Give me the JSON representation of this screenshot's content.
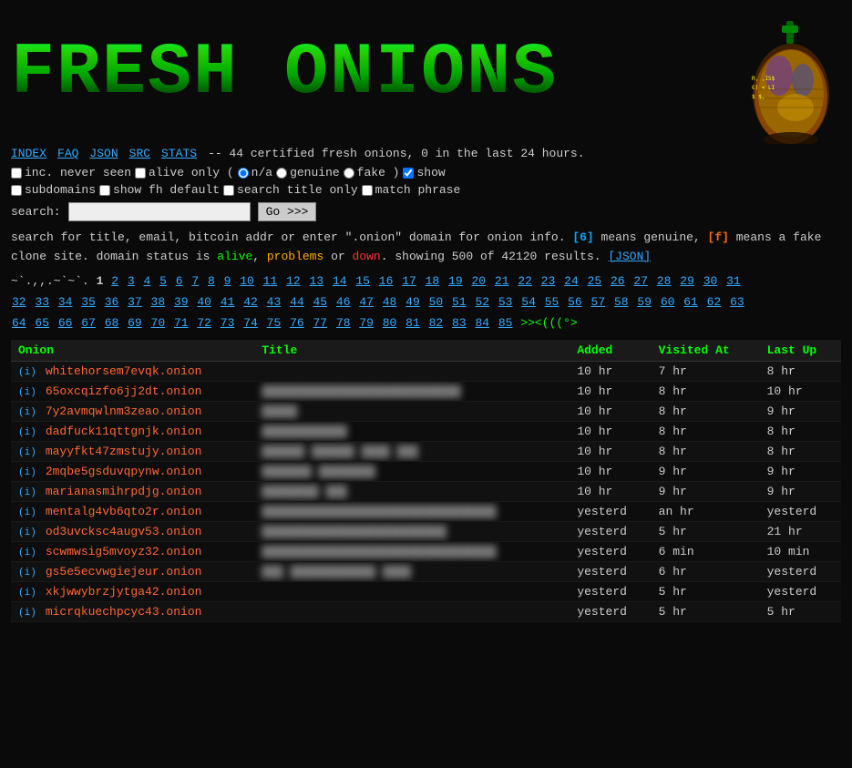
{
  "logo": {
    "text": "FR€SH ON¡ONS",
    "display": "FRESH ONIONS"
  },
  "nav": {
    "links": [
      {
        "label": "INDEX",
        "id": "index"
      },
      {
        "label": "FAQ",
        "id": "faq"
      },
      {
        "label": "JSON",
        "id": "json"
      },
      {
        "label": "SRC",
        "id": "src"
      },
      {
        "label": "STATS",
        "id": "stats"
      }
    ],
    "tagline": "-- 44 certified fresh onions, 0 in the last 24 hours."
  },
  "options": {
    "inc_never_seen": false,
    "alive_only": false,
    "status": "n/a",
    "show_subdomains": false,
    "show_fh_default": false,
    "search_title_only": false,
    "match_phrase": false,
    "show_checked": true
  },
  "search": {
    "label": "search:",
    "placeholder": "",
    "button": "Go >>>"
  },
  "help": {
    "line1": "search for title, email, bitcoin addr or enter \".onion\" domain for onion info.",
    "genuine_label": "[G]",
    "genuine_desc": "means genuine,",
    "fake_label": "[F]",
    "fake_desc": "means a fake clone site. domain status is",
    "alive": "alive",
    "problems": "problems",
    "or": "or",
    "down": "down",
    "showing": ". showing 500 of 42120 results.",
    "json_link": "[JSON]"
  },
  "pagination": {
    "sym_start": "~`.,,.~`~`.",
    "current": "1",
    "pages": [
      "2",
      "3",
      "4",
      "5",
      "6",
      "7",
      "8",
      "9",
      "10",
      "11",
      "12",
      "13",
      "14",
      "15",
      "16",
      "17",
      "18",
      "19",
      "20",
      "21",
      "22",
      "23",
      "24",
      "25",
      "26",
      "27",
      "28",
      "29",
      "30",
      "31",
      "32",
      "33",
      "34",
      "35",
      "36",
      "37",
      "38",
      "39",
      "40",
      "41",
      "42",
      "43",
      "44",
      "45",
      "46",
      "47",
      "48",
      "49",
      "50",
      "51",
      "52",
      "53",
      "54",
      "55",
      "56",
      "57",
      "58",
      "59",
      "60",
      "61",
      "62",
      "63",
      "64",
      "65",
      "66",
      "67",
      "68",
      "69",
      "70",
      "71",
      "72",
      "73",
      "74",
      "75",
      "76",
      "77",
      "78",
      "79",
      "80",
      "81",
      "82",
      "83",
      "84",
      "85"
    ],
    "end_sym": ">><(((°>"
  },
  "table": {
    "headers": [
      "Onion",
      "Title",
      "Added",
      "Visited At",
      "Last Up"
    ],
    "rows": [
      {
        "i": "i",
        "onion": "whitehorsem7evqk.onion",
        "title": "",
        "added": "10 hr",
        "visited": "7 hr",
        "last_up": "8 hr",
        "blurred": false
      },
      {
        "i": "i",
        "onion": "65oxcqizfo6jj2dt.onion",
        "title": "████████████████████████████",
        "added": "10 hr",
        "visited": "8 hr",
        "last_up": "10 hr",
        "blurred": true
      },
      {
        "i": "i",
        "onion": "7y2avmqwlnm3zeao.onion",
        "title": "█████",
        "added": "10 hr",
        "visited": "8 hr",
        "last_up": "9 hr",
        "blurred": true
      },
      {
        "i": "i",
        "onion": "dadfuck11qttgnjk.onion",
        "title": "████████████",
        "added": "10 hr",
        "visited": "8 hr",
        "last_up": "8 hr",
        "blurred": true
      },
      {
        "i": "i",
        "onion": "mayyfkt47zmstujy.onion",
        "title": "██████ ██████ ████ ███",
        "added": "10 hr",
        "visited": "8 hr",
        "last_up": "8 hr",
        "blurred": true
      },
      {
        "i": "i",
        "onion": "2mqbe5gsduvqpynw.onion",
        "title": "███████ ████████",
        "added": "10 hr",
        "visited": "9 hr",
        "last_up": "9 hr",
        "blurred": true
      },
      {
        "i": "i",
        "onion": "marianasmihrpdjg.onion",
        "title": "████████ ███",
        "added": "10 hr",
        "visited": "9 hr",
        "last_up": "9 hr",
        "blurred": true
      },
      {
        "i": "i",
        "onion": "mentalg4vb6qto2r.onion",
        "title": "█████████████████████████████████",
        "added": "yesterd",
        "visited": "an hr",
        "last_up": "yesterd",
        "blurred": true
      },
      {
        "i": "i",
        "onion": "od3uvcksc4augv53.onion",
        "title": "██████████████████████████",
        "added": "yesterd",
        "visited": "5 hr",
        "last_up": "21 hr",
        "blurred": true
      },
      {
        "i": "i",
        "onion": "scwmwsig5mvoyz32.onion",
        "title": "█████████████████████████████████",
        "added": "yesterd",
        "visited": "6 min",
        "last_up": "10 min",
        "blurred": true
      },
      {
        "i": "i",
        "onion": "gs5e5ecvwgiejeur.onion",
        "title": "███ ████████████ ████",
        "added": "yesterd",
        "visited": "6 hr",
        "last_up": "yesterd",
        "blurred": true
      },
      {
        "i": "i",
        "onion": "xkjwwybrzjytga42.onion",
        "title": "",
        "added": "yesterd",
        "visited": "5 hr",
        "last_up": "yesterd",
        "blurred": false
      },
      {
        "i": "i",
        "onion": "micrqkuechpcyc43.onion",
        "title": "",
        "added": "yesterd",
        "visited": "5 hr",
        "last_up": "5 hr",
        "blurred": false
      }
    ]
  }
}
